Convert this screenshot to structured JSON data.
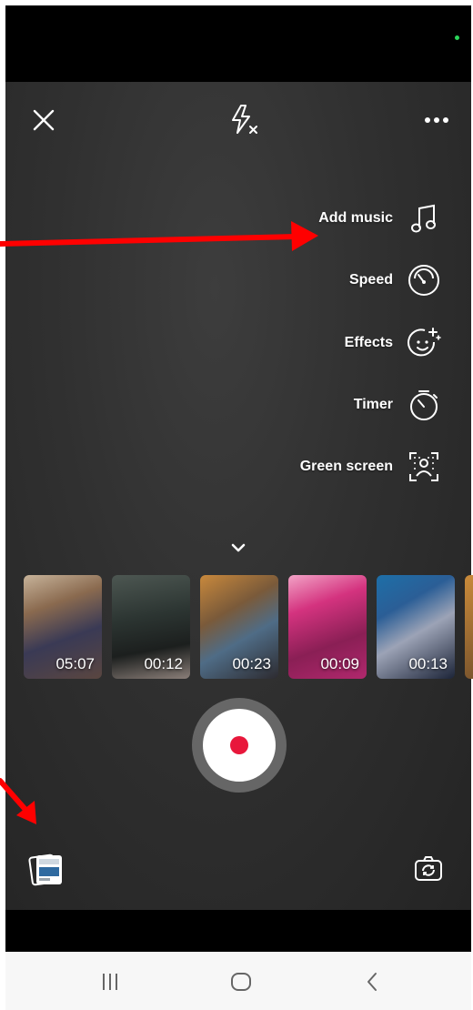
{
  "top_bar": {
    "close_icon": "close-icon",
    "flash_icon": "flash-off-icon",
    "more_icon": "more-options-icon"
  },
  "side_menu": [
    {
      "label": "Add music",
      "icon": "music-note-icon"
    },
    {
      "label": "Speed",
      "icon": "speedometer-icon"
    },
    {
      "label": "Effects",
      "icon": "sparkle-face-icon"
    },
    {
      "label": "Timer",
      "icon": "stopwatch-icon"
    },
    {
      "label": "Green screen",
      "icon": "green-screen-icon"
    }
  ],
  "collapse_icon": "chevron-down-icon",
  "gallery": [
    {
      "duration": "05:07"
    },
    {
      "duration": "00:12"
    },
    {
      "duration": "00:23"
    },
    {
      "duration": "00:09"
    },
    {
      "duration": "00:13"
    }
  ],
  "record_button": "record-icon",
  "bottom_controls": {
    "gallery_icon": "gallery-stack-icon",
    "flip_icon": "flip-camera-icon"
  },
  "colors": {
    "record": "#e8173b",
    "annotation_arrow": "#ff0000"
  },
  "system_nav": {
    "recents_icon": "recents-icon",
    "home_icon": "home-icon",
    "back_icon": "back-icon"
  }
}
